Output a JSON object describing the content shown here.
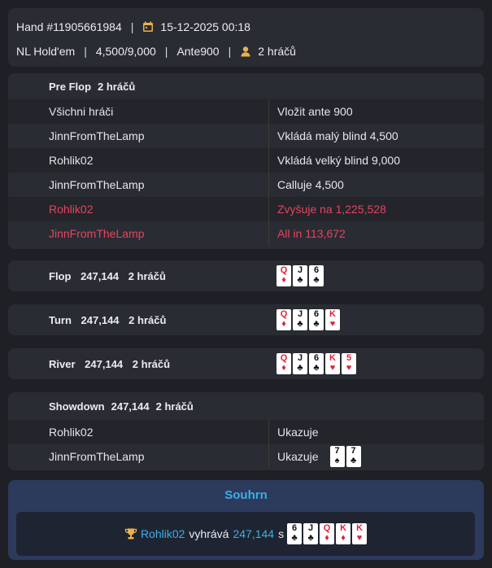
{
  "header": {
    "hand_id": "Hand #11905661984",
    "datetime": "15-12-2025 00:18",
    "game": "NL Hold'em",
    "stakes": "4,500/9,000",
    "ante": "Ante900",
    "players": "2 hráčů",
    "separator": "|",
    "colors": {
      "calendar_icon": "#e8b34a",
      "player_icon": "#e8b34a"
    }
  },
  "preflop": {
    "name": "Pre Flop",
    "players": "2 hráčů",
    "actions": [
      {
        "player": "Všichni hráči",
        "action": "Vložit ante 900",
        "highlight": false
      },
      {
        "player": "JinnFromTheLamp",
        "action": "Vkládá malý blind 4,500",
        "highlight": false
      },
      {
        "player": "Rohlik02",
        "action": "Vkládá velký blind 9,000",
        "highlight": false
      },
      {
        "player": "JinnFromTheLamp",
        "action": "Calluje 4,500",
        "highlight": false
      },
      {
        "player": "Rohlik02",
        "action": "Zvyšuje na 1,225,528",
        "highlight": true
      },
      {
        "player": "JinnFromTheLamp",
        "action": "All in 113,672",
        "highlight": true
      }
    ]
  },
  "flop": {
    "name": "Flop",
    "pot": "247,144",
    "players": "2 hráčů",
    "cards": [
      {
        "rank": "Q",
        "suit": "♦",
        "color": "red"
      },
      {
        "rank": "J",
        "suit": "♣",
        "color": "black"
      },
      {
        "rank": "6",
        "suit": "♣",
        "color": "black"
      }
    ]
  },
  "turn": {
    "name": "Turn",
    "pot": "247,144",
    "players": "2 hráčů",
    "cards": [
      {
        "rank": "Q",
        "suit": "♦",
        "color": "red"
      },
      {
        "rank": "J",
        "suit": "♣",
        "color": "black"
      },
      {
        "rank": "6",
        "suit": "♣",
        "color": "black"
      },
      {
        "rank": "K",
        "suit": "♥",
        "color": "red"
      }
    ]
  },
  "river": {
    "name": "River",
    "pot": "247,144",
    "players": "2 hráčů",
    "cards": [
      {
        "rank": "Q",
        "suit": "♦",
        "color": "red"
      },
      {
        "rank": "J",
        "suit": "♣",
        "color": "black"
      },
      {
        "rank": "6",
        "suit": "♣",
        "color": "black"
      },
      {
        "rank": "K",
        "suit": "♥",
        "color": "red"
      },
      {
        "rank": "5",
        "suit": "♥",
        "color": "red"
      }
    ]
  },
  "showdown": {
    "name": "Showdown",
    "pot": "247,144",
    "players": "2 hráčů",
    "rows": [
      {
        "player": "Rohlik02",
        "action": "Ukazuje",
        "cards": []
      },
      {
        "player": "JinnFromTheLamp",
        "action": "Ukazuje",
        "cards": [
          {
            "rank": "7",
            "suit": "♠",
            "color": "black"
          },
          {
            "rank": "7",
            "suit": "♣",
            "color": "black"
          }
        ]
      }
    ]
  },
  "summary": {
    "title": "Souhrn",
    "winner": "Rohlik02",
    "wins_text": "vyhrává",
    "amount": "247,144",
    "with_text": "s",
    "trophy_icon": "trophy-icon",
    "cards": [
      {
        "rank": "6",
        "suit": "♣",
        "color": "black"
      },
      {
        "rank": "J",
        "suit": "♣",
        "color": "black"
      },
      {
        "rank": "Q",
        "suit": "♦",
        "color": "red"
      },
      {
        "rank": "K",
        "suit": "♦",
        "color": "red"
      },
      {
        "rank": "K",
        "suit": "♥",
        "color": "red"
      }
    ]
  }
}
